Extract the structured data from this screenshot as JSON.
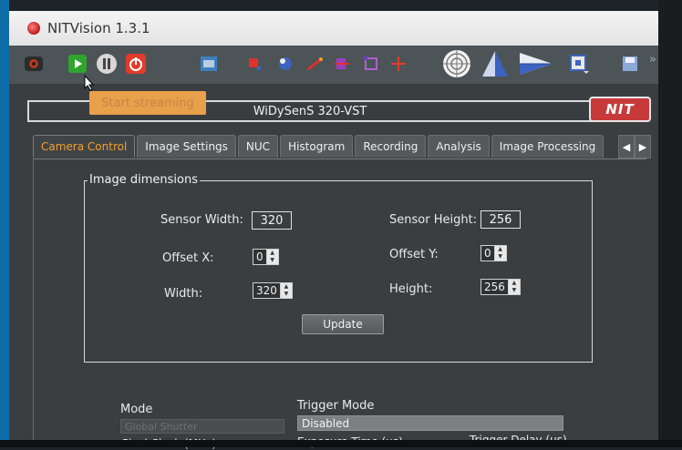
{
  "window": {
    "title": "NITVision 1.3.1"
  },
  "toolbar": {
    "tooltip": "Start streaming",
    "icons": [
      "camera-icon",
      "play-icon",
      "pause-icon",
      "power-icon",
      "grid-icon",
      "crop-icon",
      "puzzle-icon",
      "line-icon",
      "transform-icon",
      "frame-icon",
      "crosshair-icon",
      "target-icon",
      "triangle-icon",
      "arrow-icon",
      "settings-icon",
      "save-icon",
      "chevron-right-icon"
    ]
  },
  "device": {
    "name": "WiDySenS 320-VST",
    "brand": "NIT"
  },
  "tabs": [
    {
      "label": "Camera Control",
      "active": true
    },
    {
      "label": "Image Settings",
      "active": false
    },
    {
      "label": "NUC",
      "active": false
    },
    {
      "label": "Histogram",
      "active": false
    },
    {
      "label": "Recording",
      "active": false
    },
    {
      "label": "Analysis",
      "active": false
    },
    {
      "label": "Image Processing",
      "active": false
    }
  ],
  "image_dimensions": {
    "title": "Image dimensions",
    "sensor_width_label": "Sensor Width:",
    "sensor_width": "320",
    "sensor_height_label": "Sensor Height:",
    "sensor_height": "256",
    "offset_x_label": "Offset X:",
    "offset_x": "0",
    "offset_y_label": "Offset Y:",
    "offset_y": "0",
    "width_label": "Width:",
    "width": "320",
    "height_label": "Height:",
    "height": "256",
    "update_label": "Update"
  },
  "acquisition": {
    "mode_label": "Mode",
    "mode_value": "Global Shutter",
    "trigger_mode_label": "Trigger Mode",
    "trigger_mode_value": "Disabled",
    "pixel_clock_label": "Pixel Clock (MHz)",
    "exposure_label": "Exposure Time (us)",
    "trigger_delay_label": "Trigger Delay (us)"
  },
  "colors": {
    "accent": "#f2a030",
    "toolbar": "#4c5457",
    "panel": "#3b3e40"
  }
}
